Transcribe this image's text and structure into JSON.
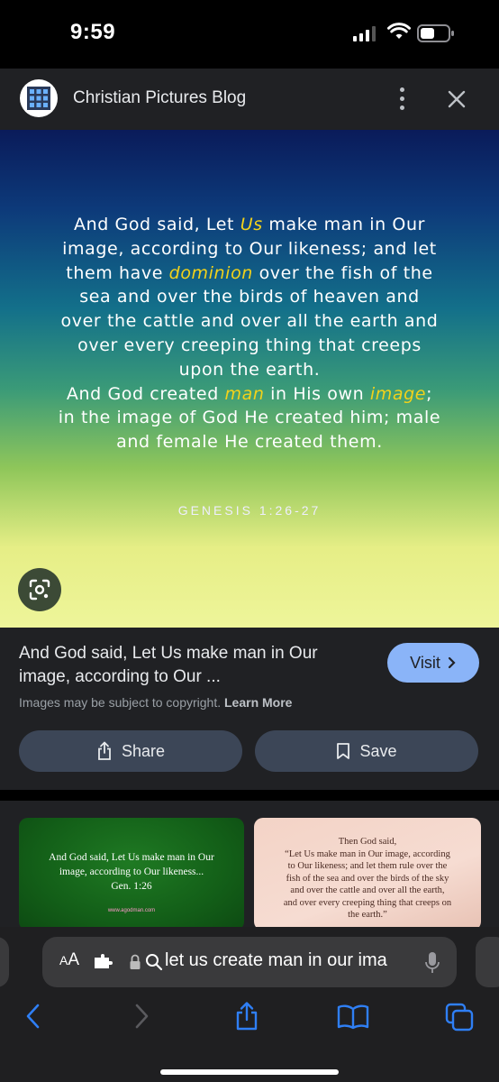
{
  "status_bar": {
    "time": "9:59"
  },
  "header": {
    "site_title": "Christian Pictures Blog",
    "icons": [
      "site-favicon",
      "more-vert-icon",
      "close-icon"
    ]
  },
  "hero": {
    "verse_lines": [
      {
        "parts": [
          {
            "t": "And God said, Let "
          },
          {
            "t": "Us",
            "hl": true
          },
          {
            "t": " make man in Our"
          }
        ]
      },
      {
        "parts": [
          {
            "t": "image, according to Our likeness; and let"
          }
        ]
      },
      {
        "parts": [
          {
            "t": "them have "
          },
          {
            "t": "dominion",
            "hl": true
          },
          {
            "t": " over the fish of the"
          }
        ]
      },
      {
        "parts": [
          {
            "t": "sea and over the birds of heaven and"
          }
        ]
      },
      {
        "parts": [
          {
            "t": "over the cattle and over all the earth and"
          }
        ]
      },
      {
        "parts": [
          {
            "t": "over every creeping thing that creeps"
          }
        ]
      },
      {
        "parts": [
          {
            "t": "upon the earth."
          }
        ]
      },
      {
        "parts": [
          {
            "t": "And God created "
          },
          {
            "t": "man",
            "hl": true
          },
          {
            "t": " in His own "
          },
          {
            "t": "image",
            "hl": true
          },
          {
            "t": ";"
          }
        ]
      },
      {
        "parts": [
          {
            "t": "in the image of God He created him; male"
          }
        ]
      },
      {
        "parts": [
          {
            "t": "and female He created them."
          }
        ]
      }
    ],
    "reference": "GENESIS 1:26-27",
    "highlight_color": "#f2d21a"
  },
  "details": {
    "caption_line1": "And God said, Let Us make man in Our",
    "caption_line2": "image, according to Our ...",
    "visit_label": "Visit",
    "copyright_text": "Images may be subject to copyright.",
    "learn_more_label": "Learn More",
    "share_label": "Share",
    "save_label": "Save"
  },
  "related": {
    "thumb1_lines": [
      "And God said, Let Us make man in Our",
      "image, according to Our likeness...",
      "Gen. 1:26"
    ],
    "thumb1_url": "www.agodman.com",
    "thumb2_lines": [
      "Then God said,",
      "“Let Us make man in Our image, according",
      "to Our likeness; and let them rule over the",
      "fish of the sea and over the birds of the sky",
      "and over the cattle and over all the earth,",
      "and over every creeping thing that creeps on",
      "the earth.”"
    ]
  },
  "browser": {
    "aa_label_small": "A",
    "aa_label_large": "A",
    "url_text": "let us create man in our ima",
    "toolbar_icons": [
      "back-icon",
      "forward-icon",
      "share-icon",
      "bookmarks-icon",
      "tabs-icon"
    ]
  },
  "colors": {
    "accent": "#8ab4f8",
    "button_bg": "#3c4657",
    "browser_blue": "#2f7ff5"
  }
}
